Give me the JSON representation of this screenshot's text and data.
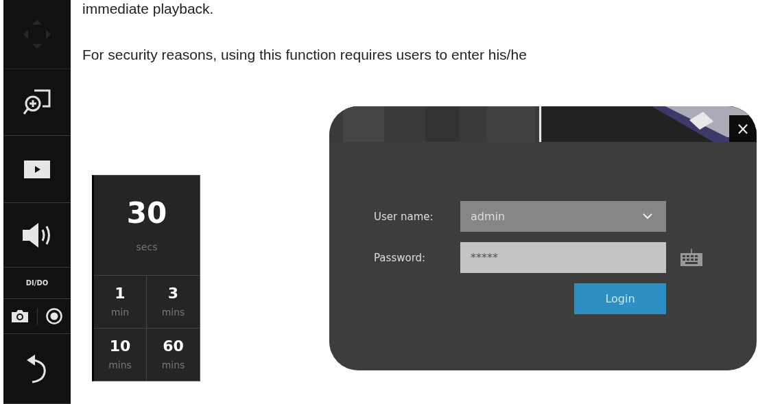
{
  "document": {
    "paragraphs": [
      "immediate playback.",
      "For security reasons, using this function requires users to enter his/he"
    ]
  },
  "toolbar": {
    "items": [
      {
        "kind": "ptz",
        "disabled": true
      },
      {
        "kind": "zoom",
        "disabled": false
      },
      {
        "kind": "playback",
        "disabled": false
      },
      {
        "kind": "volume",
        "disabled": false
      },
      {
        "kind": "label",
        "label": "DI/DO",
        "disabled": false
      },
      {
        "kind": "pair",
        "disabled": false
      },
      {
        "kind": "back",
        "disabled": false
      }
    ]
  },
  "duration_panel": {
    "main": {
      "value": "30",
      "unit": "secs"
    },
    "options": [
      {
        "value": "1",
        "unit": "min"
      },
      {
        "value": "3",
        "unit": "mins"
      },
      {
        "value": "10",
        "unit": "mins"
      },
      {
        "value": "60",
        "unit": "mins"
      }
    ]
  },
  "login_dialog": {
    "close": "×",
    "user_label": "User name:",
    "user_value": "admin",
    "password_label": "Password:",
    "password_value": "*****",
    "button": "Login"
  }
}
